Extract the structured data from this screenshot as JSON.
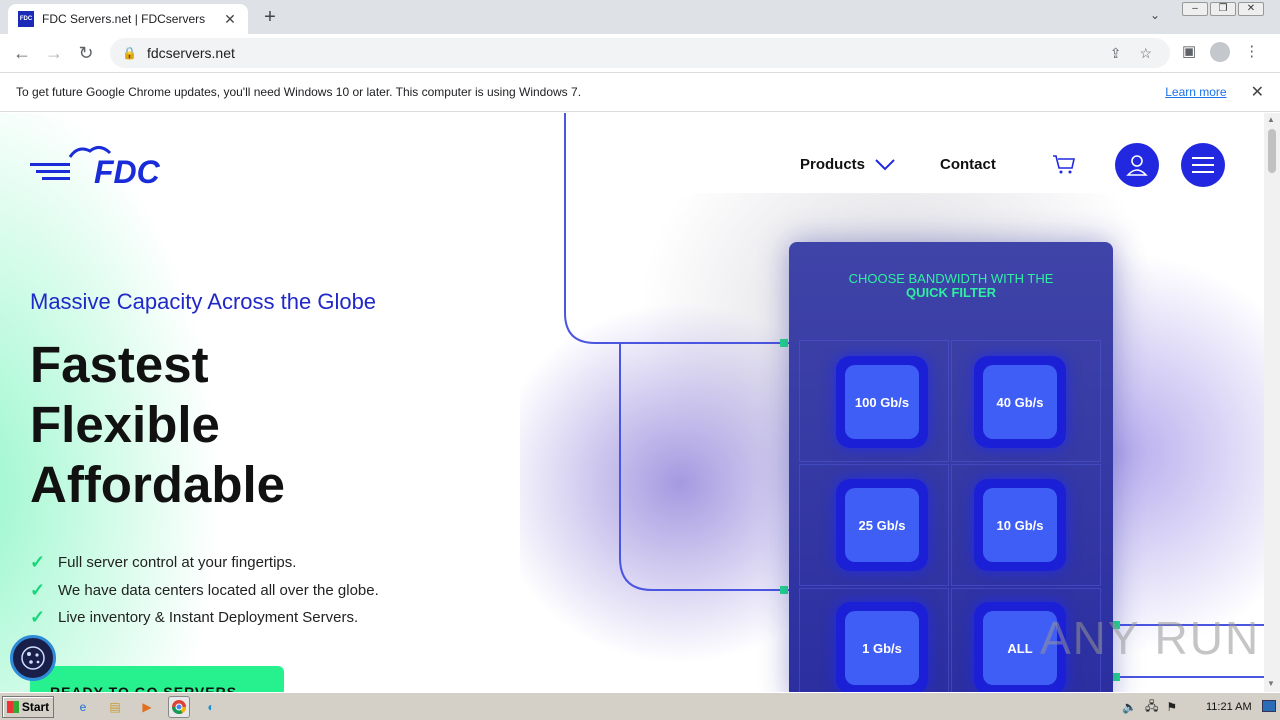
{
  "browser": {
    "tab_title": "FDC Servers.net | FDCservers",
    "favicon_text": "FDC",
    "new_tab": "+",
    "url": "fdcservers.net"
  },
  "infobar": {
    "message": "To get future Google Chrome updates, you'll need Windows 10 or later. This computer is using Windows 7.",
    "link": "Learn more"
  },
  "site": {
    "nav": {
      "products": "Products",
      "contact": "Contact"
    },
    "tagline": "Massive Capacity Across the Globe",
    "headline": [
      "Fastest",
      "Flexible",
      "Affordable"
    ],
    "features": [
      "Full server control at your fingertips.",
      "We have data centers located all over the globe.",
      "Live inventory & Instant Deployment Servers."
    ],
    "cta": "READY TO GO SERVERS"
  },
  "filter_panel": {
    "title_line1": "CHOOSE BANDWIDTH WITH THE",
    "title_line2": "QUICK FILTER",
    "options": [
      "100 Gb/s",
      "40 Gb/s",
      "25 Gb/s",
      "10 Gb/s",
      "1 Gb/s",
      "ALL"
    ]
  },
  "watermark": "ANY RUN",
  "taskbar": {
    "start": "Start",
    "clock": "11:21 AM"
  },
  "colors": {
    "brand_blue": "#2128e0",
    "accent_green": "#27f08f",
    "panel_bg": "#2b2ea0"
  }
}
